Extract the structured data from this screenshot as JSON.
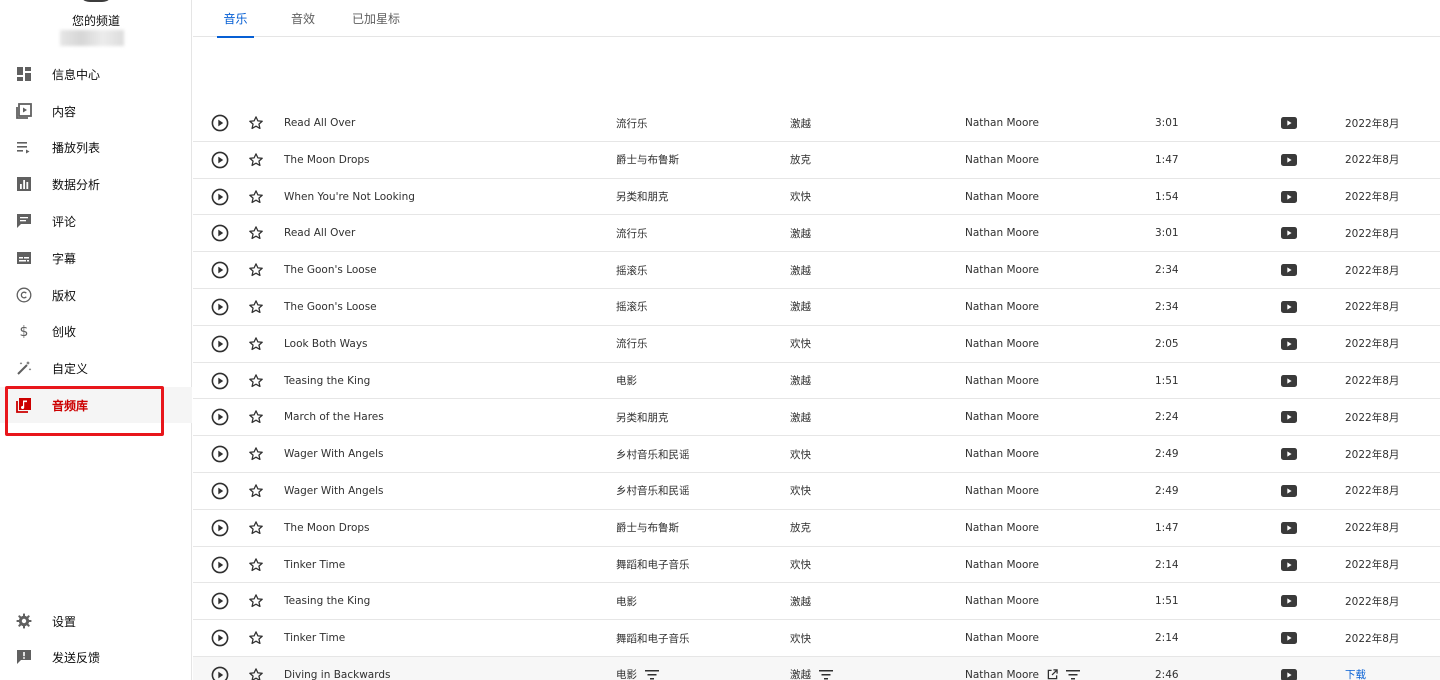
{
  "channel": {
    "title": "您的频道"
  },
  "sidebar": {
    "items": [
      {
        "label": "信息中心",
        "icon": "dashboard-icon"
      },
      {
        "label": "内容",
        "icon": "video-library-icon"
      },
      {
        "label": "播放列表",
        "icon": "playlist-icon"
      },
      {
        "label": "数据分析",
        "icon": "analytics-icon"
      },
      {
        "label": "评论",
        "icon": "comment-icon"
      },
      {
        "label": "字幕",
        "icon": "subtitles-icon"
      },
      {
        "label": "版权",
        "icon": "copyright-icon"
      },
      {
        "label": "创收",
        "icon": "dollar-icon"
      },
      {
        "label": "自定义",
        "icon": "magic-wand-icon"
      },
      {
        "label": "音频库",
        "icon": "audio-library-icon",
        "active": true
      }
    ],
    "bottom": [
      {
        "label": "设置",
        "icon": "gear-icon"
      },
      {
        "label": "发送反馈",
        "icon": "feedback-icon"
      }
    ]
  },
  "tabs": [
    {
      "label": "音乐",
      "active": true
    },
    {
      "label": "音效"
    },
    {
      "label": "已加星标"
    }
  ],
  "tracks": [
    {
      "title": "Read All Over",
      "genre": "流行乐",
      "mood": "激越",
      "artist": "Nathan Moore",
      "duration": "3:01",
      "date": "2022年8月"
    },
    {
      "title": "The Moon Drops",
      "genre": "爵士与布鲁斯",
      "mood": "放克",
      "artist": "Nathan Moore",
      "duration": "1:47",
      "date": "2022年8月"
    },
    {
      "title": "When You're Not Looking",
      "genre": "另类和朋克",
      "mood": "欢快",
      "artist": "Nathan Moore",
      "duration": "1:54",
      "date": "2022年8月"
    },
    {
      "title": "Read All Over",
      "genre": "流行乐",
      "mood": "激越",
      "artist": "Nathan Moore",
      "duration": "3:01",
      "date": "2022年8月"
    },
    {
      "title": "The Goon's Loose",
      "genre": "摇滚乐",
      "mood": "激越",
      "artist": "Nathan Moore",
      "duration": "2:34",
      "date": "2022年8月"
    },
    {
      "title": "The Goon's Loose",
      "genre": "摇滚乐",
      "mood": "激越",
      "artist": "Nathan Moore",
      "duration": "2:34",
      "date": "2022年8月"
    },
    {
      "title": "Look Both Ways",
      "genre": "流行乐",
      "mood": "欢快",
      "artist": "Nathan Moore",
      "duration": "2:05",
      "date": "2022年8月"
    },
    {
      "title": "Teasing the King",
      "genre": "电影",
      "mood": "激越",
      "artist": "Nathan Moore",
      "duration": "1:51",
      "date": "2022年8月"
    },
    {
      "title": "March of the Hares",
      "genre": "另类和朋克",
      "mood": "激越",
      "artist": "Nathan Moore",
      "duration": "2:24",
      "date": "2022年8月"
    },
    {
      "title": "Wager With Angels",
      "genre": "乡村音乐和民谣",
      "mood": "欢快",
      "artist": "Nathan Moore",
      "duration": "2:49",
      "date": "2022年8月"
    },
    {
      "title": "Wager With Angels",
      "genre": "乡村音乐和民谣",
      "mood": "欢快",
      "artist": "Nathan Moore",
      "duration": "2:49",
      "date": "2022年8月"
    },
    {
      "title": "The Moon Drops",
      "genre": "爵士与布鲁斯",
      "mood": "放克",
      "artist": "Nathan Moore",
      "duration": "1:47",
      "date": "2022年8月"
    },
    {
      "title": "Tinker Time",
      "genre": "舞蹈和电子音乐",
      "mood": "欢快",
      "artist": "Nathan Moore",
      "duration": "2:14",
      "date": "2022年8月"
    },
    {
      "title": "Teasing the King",
      "genre": "电影",
      "mood": "激越",
      "artist": "Nathan Moore",
      "duration": "1:51",
      "date": "2022年8月"
    },
    {
      "title": "Tinker Time",
      "genre": "舞蹈和电子音乐",
      "mood": "欢快",
      "artist": "Nathan Moore",
      "duration": "2:14",
      "date": "2022年8月"
    },
    {
      "title": "Diving in Backwards",
      "genre": "电影",
      "mood": "激越",
      "artist": "Nathan Moore",
      "duration": "2:46",
      "download_label": "下载",
      "hovered": true
    }
  ],
  "colors": {
    "accent": "#065fd4",
    "active_nav": "#cc0000",
    "highlight": "#e8161b"
  }
}
